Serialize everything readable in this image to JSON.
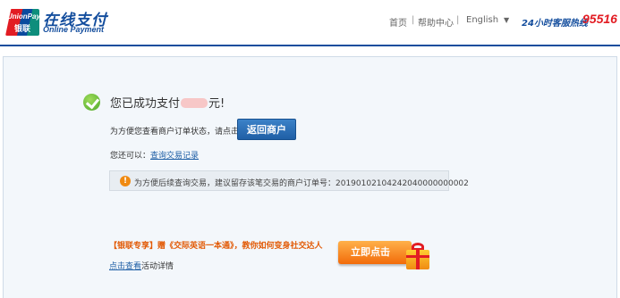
{
  "header": {
    "logo_badge_en": "UnionPay",
    "logo_badge_cn": "银联",
    "logo_title": "在线支付",
    "logo_subtitle": "Online Payment",
    "nav": {
      "home": "首页",
      "help": "帮助中心",
      "language": "English",
      "separator": "|"
    },
    "hotline_label": "24小时客服热线",
    "hotline_number": "95516"
  },
  "main": {
    "success_prefix": "您已成功支付",
    "success_suffix": "元!",
    "return_hint": "为方便您查看商户订单状态，请点击",
    "return_button": "返回商户",
    "also_label": "您还可以：",
    "query_link": "查询交易记录",
    "notice": "为方便后续查询交易，建议留存该笔交易的商户订单号：20190102104242040000000002",
    "promo": "【银联专享】赠《交际英语一本通》，教你如何变身社交达人",
    "detail_link": "点击查看",
    "detail_suffix": "活动详情",
    "cta_button": "立即点击"
  },
  "colors": {
    "brand_blue": "#134d9d",
    "brand_red": "#e21c23",
    "promo_orange": "#e25a06",
    "cta_orange": "#f26b09"
  }
}
